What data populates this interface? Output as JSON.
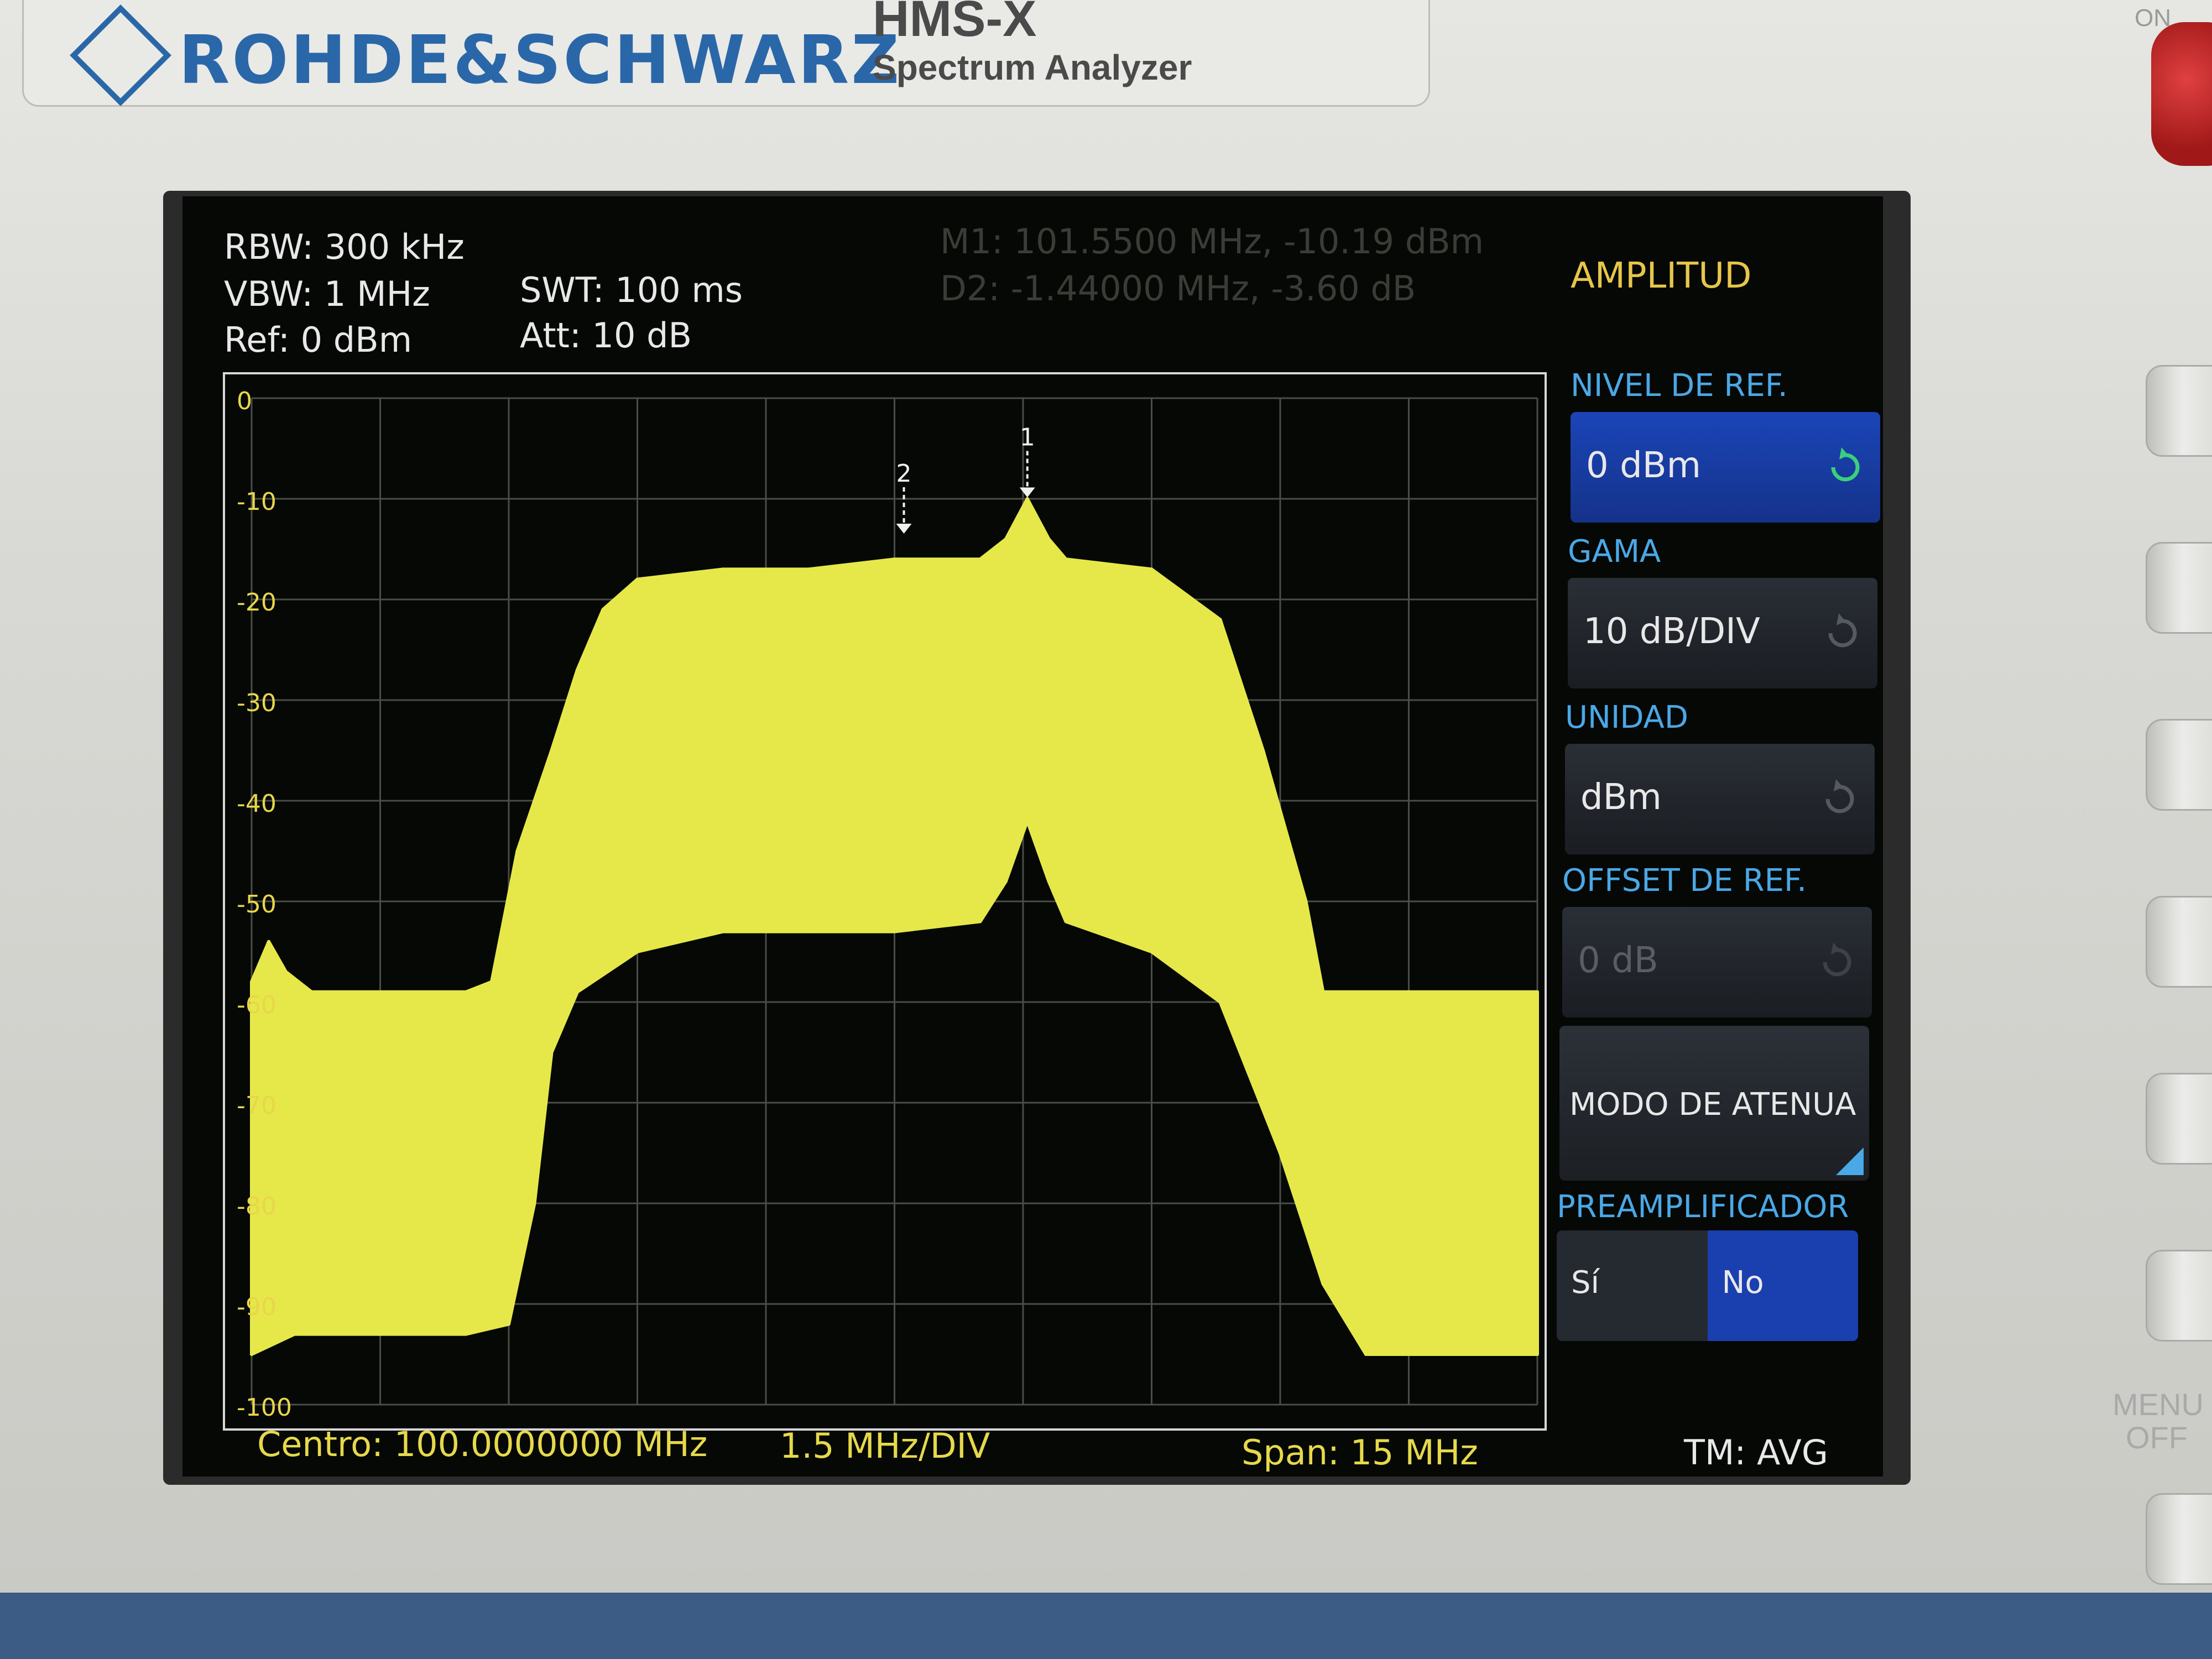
{
  "device": {
    "brand": "ROHDE&SCHWARZ",
    "model": "HMS-X",
    "model_subtitle": "Spectrum Analyzer",
    "power_label": "ON",
    "menu_off_label": "MENU OFF"
  },
  "settings": {
    "rbw": "RBW: 300 kHz",
    "vbw": "VBW: 1 MHz",
    "ref": "Ref: 0 dBm",
    "swt": "SWT: 100 ms",
    "att": "Att: 10 dB"
  },
  "markers": {
    "m1": "M1: 101.5500 MHz, -10.19 dBm",
    "d2": "D2: -1.44000 MHz, -3.60 dB",
    "m1_label": "1",
    "d2_label": "2"
  },
  "footer": {
    "center": "Centro: 100.0000000 MHz",
    "div": "1.5 MHz/DIV",
    "span": "Span: 15 MHz",
    "trace_mode": "TM: AVG"
  },
  "menu": {
    "title": "AMPLITUD",
    "ref_level_label": "NIVEL DE REF.",
    "ref_level_value": "0 dBm",
    "range_label": "GAMA",
    "range_value": "10 dB/DIV",
    "unit_label": "UNIDAD",
    "unit_value": "dBm",
    "ref_offset_label": "OFFSET DE REF.",
    "ref_offset_value": "0 dB",
    "atten_mode_label": "MODO DE ATENUA",
    "preamp_label": "PREAMPLIFICADOR",
    "preamp_options": [
      "Sí",
      "No"
    ],
    "preamp_selected": "No"
  },
  "colors": {
    "trace": "#e6e84a",
    "grid": "#4a4d46",
    "menu_label": "#4aa8e6",
    "menu_title": "#e6c64a",
    "active_box": "#1a45b8"
  },
  "chart_data": {
    "type": "line",
    "y_ticks": [
      "0",
      "-10",
      "-20",
      "-30",
      "-40",
      "-50",
      "-60",
      "-70",
      "-80",
      "-90",
      "-100"
    ],
    "ylim": [
      -100,
      0
    ],
    "xlim_mhz": [
      92.5,
      107.5
    ],
    "center_mhz": 100.0,
    "span_mhz": 15,
    "grid": true,
    "series": [
      {
        "role": "max",
        "x": [
          92.5,
          92.7,
          92.9,
          93.2,
          94.0,
          95.0,
          95.3,
          95.6,
          96.0,
          96.3,
          96.6,
          97.0,
          98.0,
          99.0,
          100.0,
          101.0,
          101.3,
          101.55,
          101.8,
          102.0,
          103.0,
          103.8,
          104.3,
          104.8,
          105.0,
          105.3,
          106.0,
          107.0,
          107.5
        ],
        "y": [
          -58,
          -54,
          -57,
          -59,
          -59,
          -59,
          -58,
          -45,
          -35,
          -27,
          -21,
          -18,
          -17,
          -17,
          -16,
          -16,
          -14,
          -10,
          -14,
          -16,
          -17,
          -22,
          -35,
          -50,
          -59,
          -59,
          -59,
          -59,
          -59
        ]
      },
      {
        "role": "min",
        "x": [
          92.5,
          93.0,
          94.0,
          95.0,
          95.5,
          95.8,
          96.0,
          96.3,
          97.0,
          98.0,
          99.0,
          100.0,
          101.0,
          101.3,
          101.55,
          101.8,
          102.0,
          103.0,
          103.8,
          104.5,
          105.0,
          105.5,
          106.0,
          107.0,
          107.5
        ],
        "y": [
          -95,
          -93,
          -93,
          -93,
          -92,
          -80,
          -65,
          -59,
          -55,
          -53,
          -53,
          -53,
          -52,
          -48,
          -42,
          -48,
          -52,
          -55,
          -60,
          -75,
          -88,
          -95,
          -95,
          -95,
          -95
        ]
      }
    ],
    "markers": [
      {
        "label": "1",
        "x": 101.55,
        "y": -10.19
      },
      {
        "label": "2",
        "x": 100.11,
        "y": -13.79
      }
    ]
  }
}
